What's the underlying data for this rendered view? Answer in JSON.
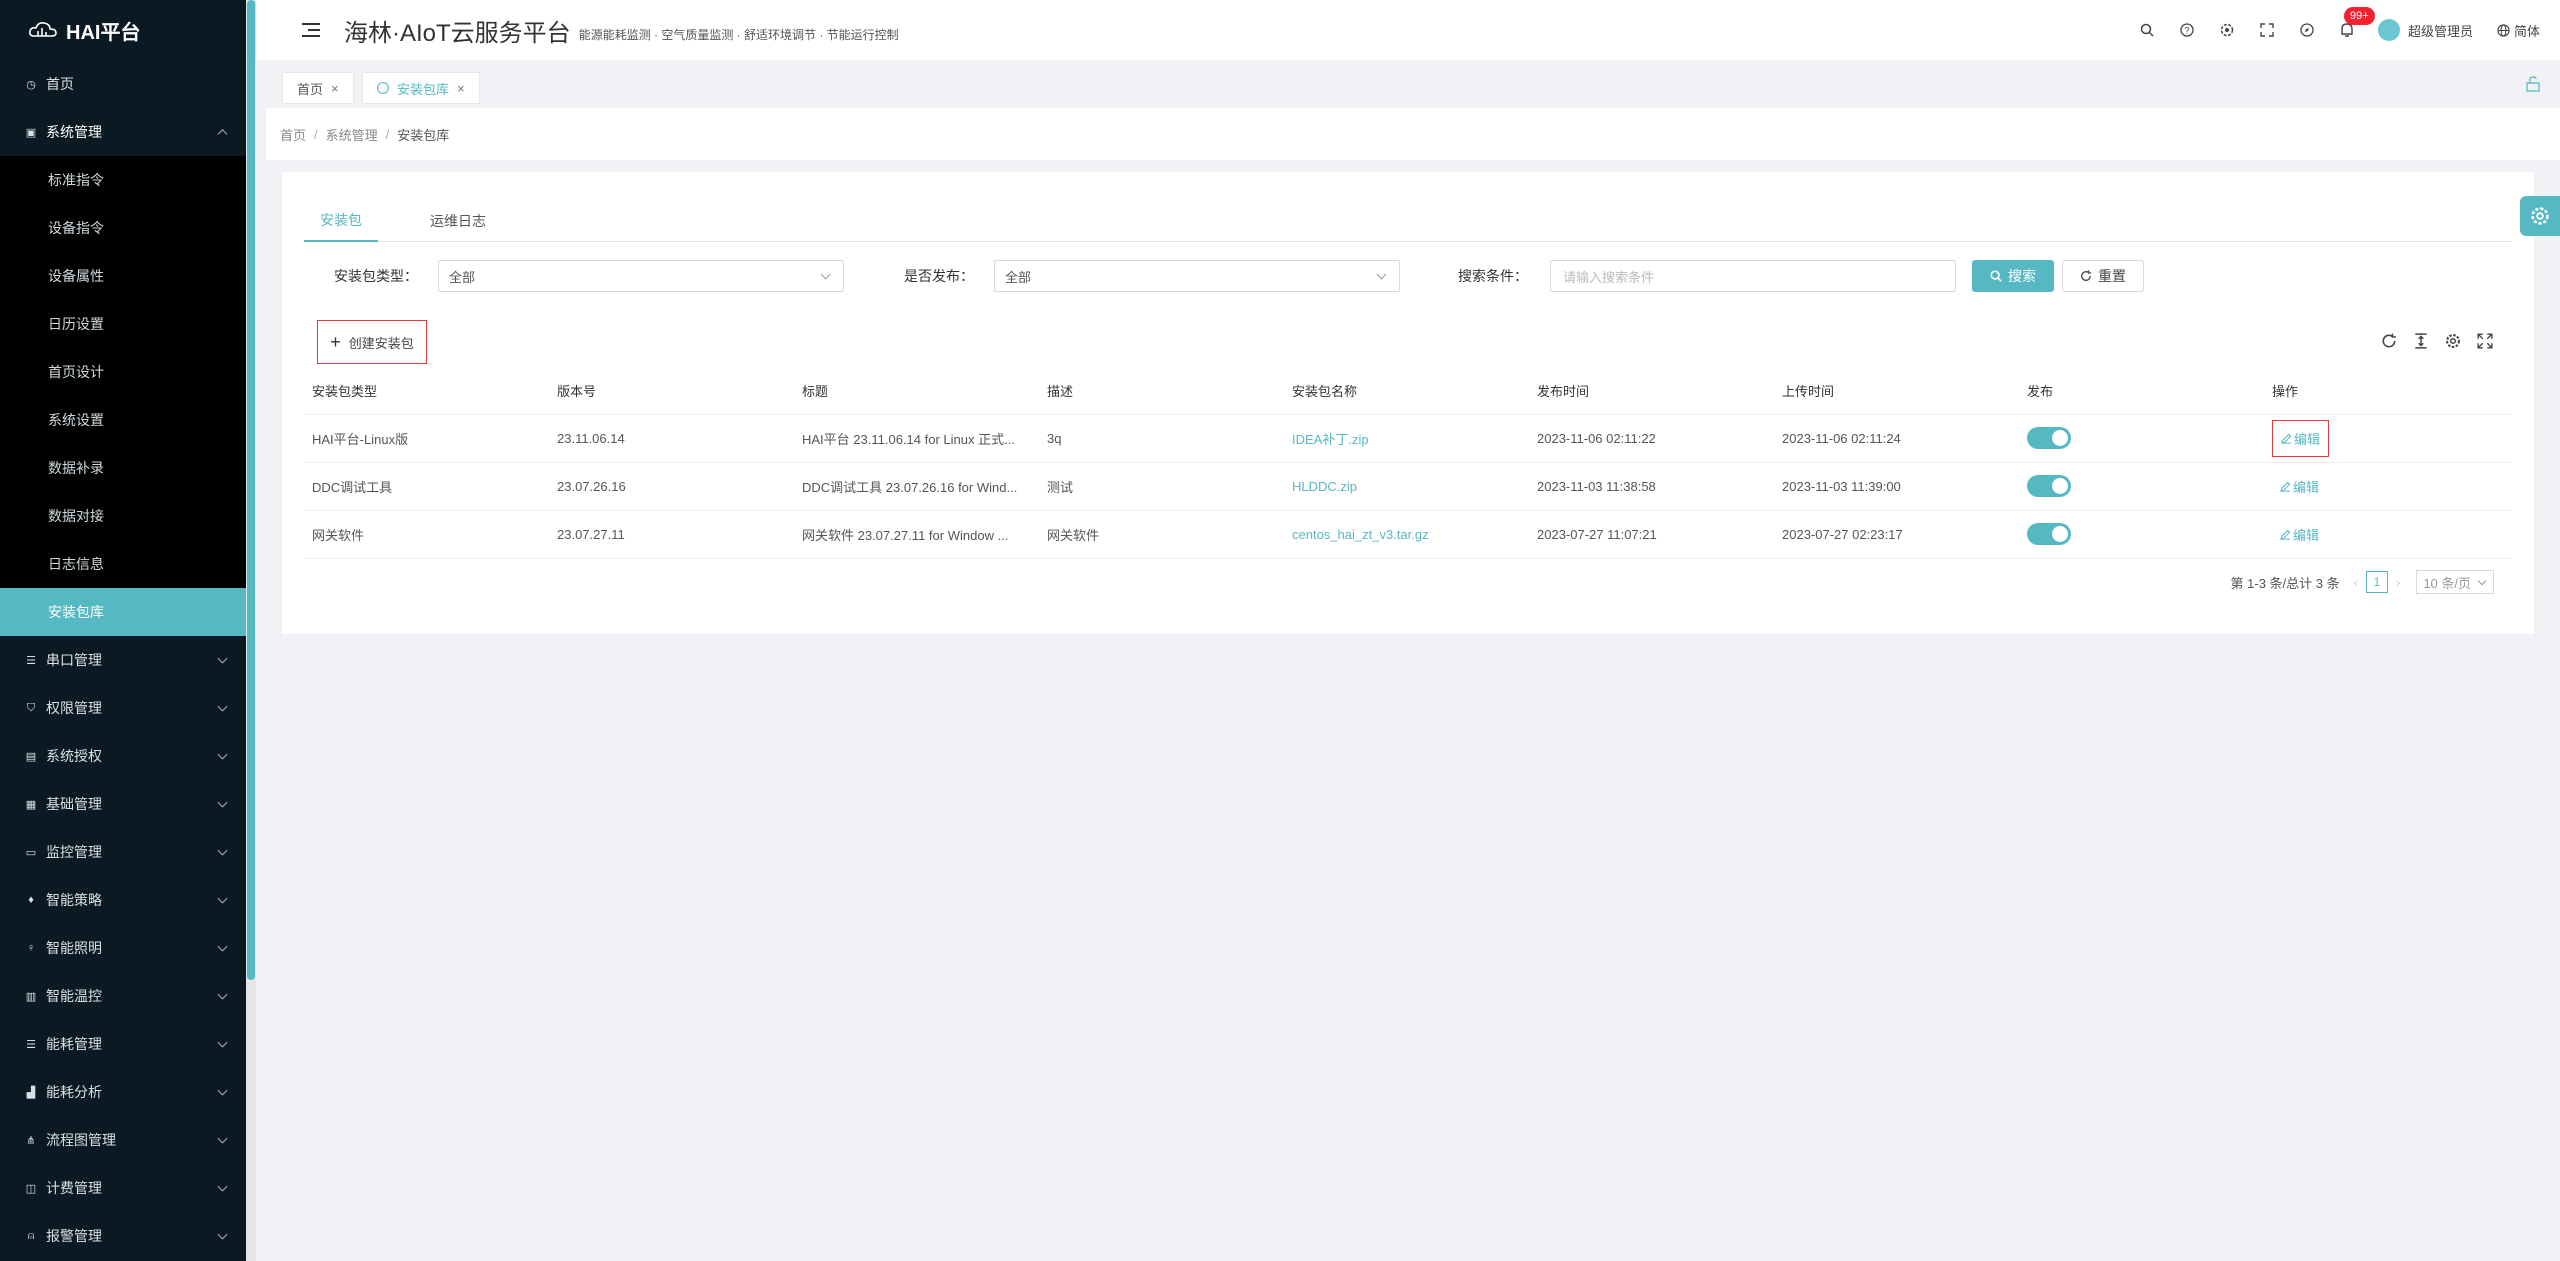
{
  "brand": {
    "name": "HAI平台"
  },
  "header": {
    "title": "海林·AIoT云服务平台",
    "subtitle": "能源能耗监测 · 空气质量监测 · 舒适环境调节 · 节能运行控制",
    "notification_count": "99+",
    "user_name": "超级管理员",
    "language": "简体"
  },
  "sidebar": {
    "items": [
      {
        "label": "首页",
        "icon": "dashboard-icon"
      },
      {
        "label": "系统管理",
        "icon": "system-icon",
        "open": true
      },
      {
        "label": "串口管理",
        "icon": "serial-icon"
      },
      {
        "label": "权限管理",
        "icon": "shield-icon"
      },
      {
        "label": "系统授权",
        "icon": "auth-icon"
      },
      {
        "label": "基础管理",
        "icon": "base-icon"
      },
      {
        "label": "监控管理",
        "icon": "monitor-icon"
      },
      {
        "label": "智能策略",
        "icon": "strategy-icon"
      },
      {
        "label": "智能照明",
        "icon": "bulb-icon"
      },
      {
        "label": "智能温控",
        "icon": "thermo-icon"
      },
      {
        "label": "能耗管理",
        "icon": "energy-icon"
      },
      {
        "label": "能耗分析",
        "icon": "analysis-icon"
      },
      {
        "label": "流程图管理",
        "icon": "flow-icon"
      },
      {
        "label": "计费管理",
        "icon": "billing-icon"
      },
      {
        "label": "报警管理",
        "icon": "alarm-icon"
      }
    ],
    "system_submenu": [
      "标准指令",
      "设备指令",
      "设备属性",
      "日历设置",
      "首页设计",
      "系统设置",
      "数据补录",
      "数据对接",
      "日志信息",
      "安装包库"
    ]
  },
  "tabs": [
    {
      "label": "首页"
    },
    {
      "label": "安装包库"
    }
  ],
  "breadcrumb": [
    "首页",
    "系统管理",
    "安装包库"
  ],
  "inner_tabs": [
    "安装包",
    "运维日志"
  ],
  "filters": {
    "type_label": "安装包类型：",
    "type_value": "全部",
    "publish_label": "是否发布：",
    "publish_value": "全部",
    "search_label": "搜索条件：",
    "search_placeholder": "请输入搜索条件",
    "search_button": "搜索",
    "reset_button": "重置"
  },
  "create_button": "创建安装包",
  "table": {
    "columns": [
      "安装包类型",
      "版本号",
      "标题",
      "描述",
      "安装包名称",
      "发布时间",
      "上传时间",
      "发布",
      "操作"
    ],
    "rows": [
      [
        "HAI平台-Linux版",
        "23.11.06.14",
        "HAI平台 23.11.06.14 for Linux 正式...",
        "3q",
        "IDEA补丁.zip",
        "2023-11-06 02:11:22",
        "2023-11-06 02:11:24",
        true,
        "编辑"
      ],
      [
        "DDC调试工具",
        "23.07.26.16",
        "DDC调试工具 23.07.26.16 for Wind...",
        "测试",
        "HLDDC.zip",
        "2023-11-03 11:38:58",
        "2023-11-03 11:39:00",
        true,
        "编辑"
      ],
      [
        "网关软件",
        "23.07.27.11",
        "网关软件 23.07.27.11 for Window ...",
        "网关软件",
        "centos_hai_zt_v3.tar.gz",
        "2023-07-27 11:07:21",
        "2023-07-27 02:23:17",
        true,
        "编辑"
      ]
    ]
  },
  "pagination": {
    "summary": "第 1-3 条/总计 3 条",
    "current_page": "1",
    "page_size": "10 条/页"
  },
  "colors": {
    "accent": "#56b8c2",
    "sidebar_bg": "#0b1a22",
    "highlight_border": "#e53935"
  }
}
